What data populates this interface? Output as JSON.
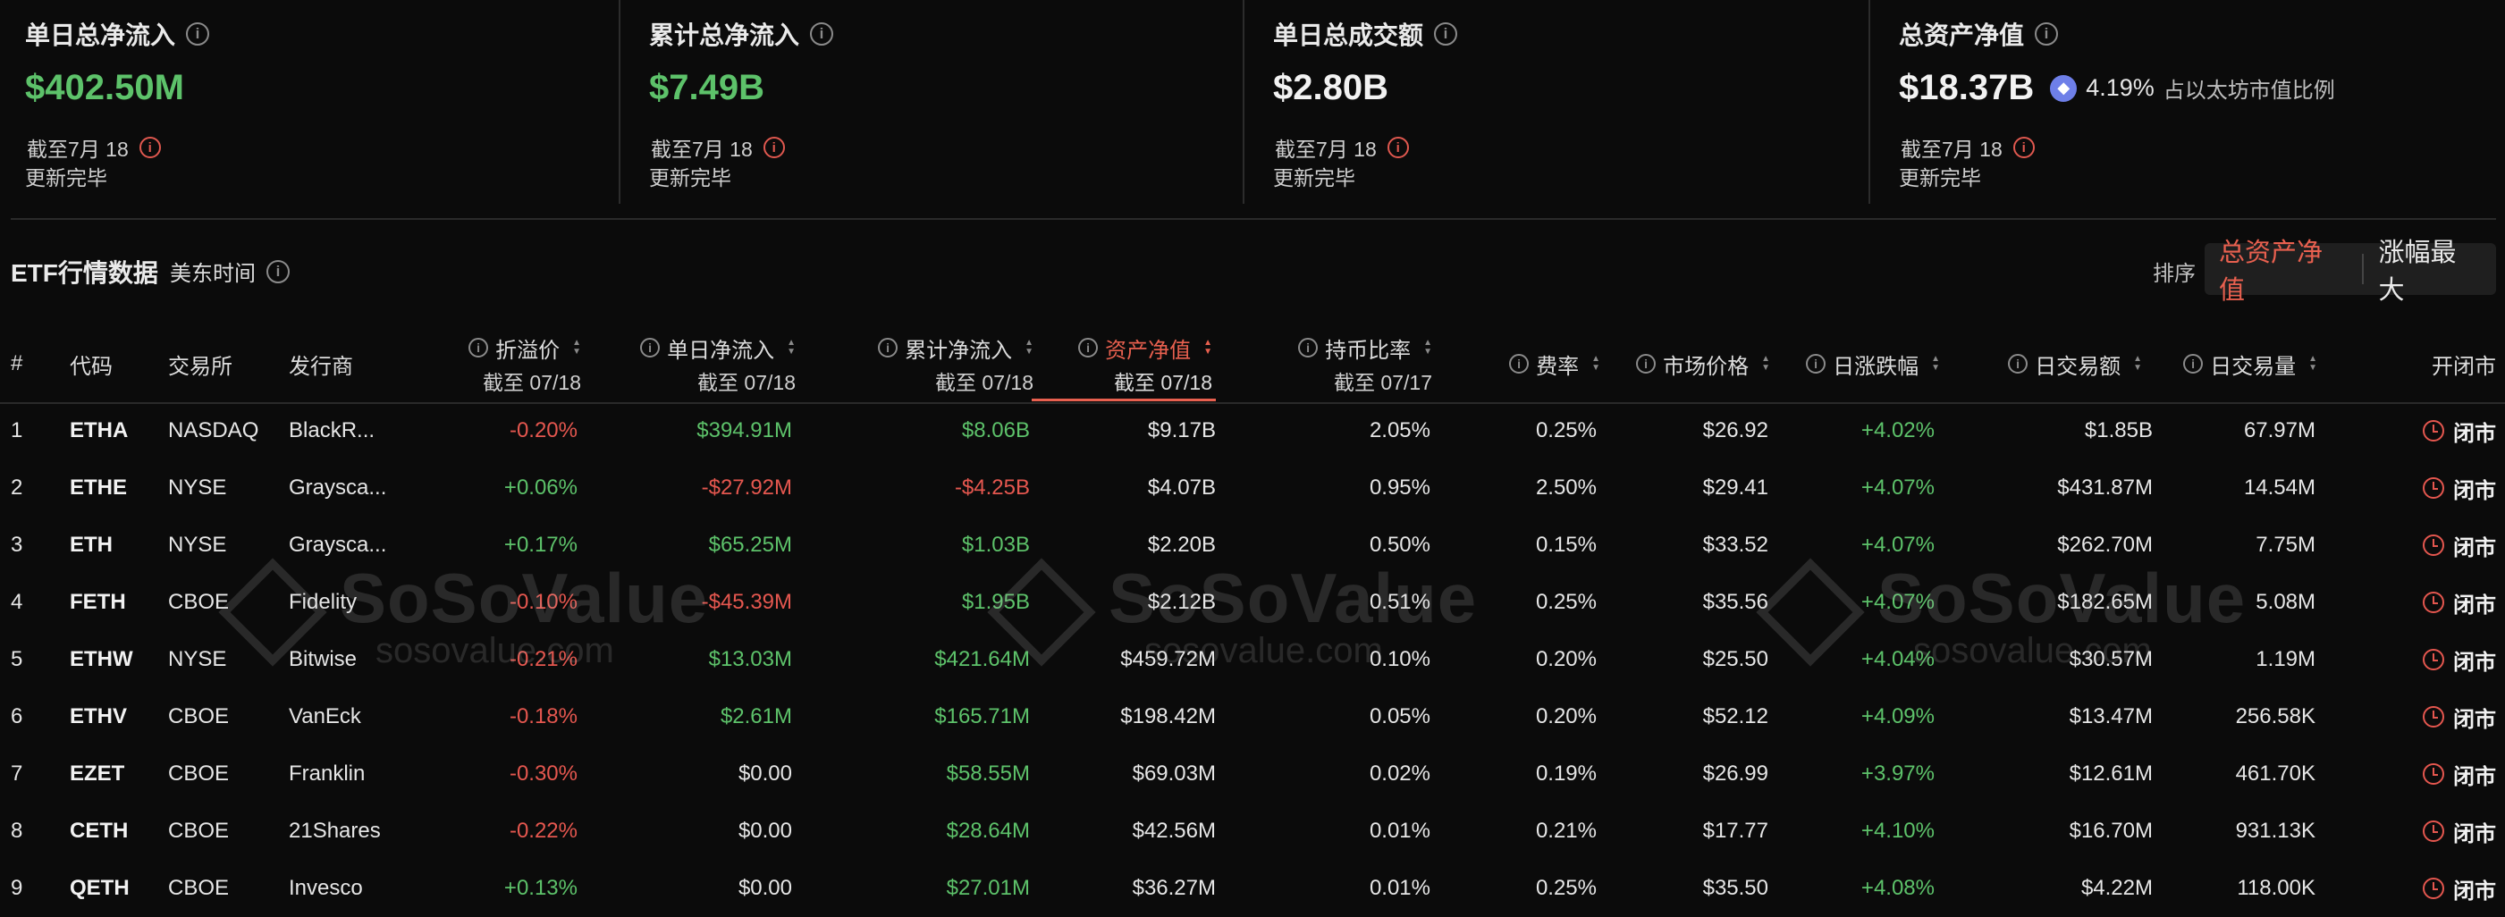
{
  "summary": [
    {
      "title": "单日总净流入",
      "value": "$402.50M",
      "date": "截至7月 18",
      "status": "更新完毕"
    },
    {
      "title": "累计总净流入",
      "value": "$7.49B",
      "date": "截至7月 18",
      "status": "更新完毕"
    },
    {
      "title": "单日总成交额",
      "value": "$2.80B",
      "date": "截至7月 18",
      "status": "更新完毕"
    },
    {
      "title": "总资产净值",
      "value": "$18.37B",
      "ratio": "4.19%",
      "ratio_label": "占以太坊市值比例",
      "date": "截至7月 18",
      "status": "更新完毕"
    }
  ],
  "section": {
    "title": "ETF行情数据",
    "timezone": "美东时间",
    "sort_label": "排序",
    "sort_options": [
      "总资产净值",
      "涨幅最大"
    ],
    "active_sort": "总资产净值"
  },
  "table": {
    "headers": {
      "index": "#",
      "code": "代码",
      "exchange": "交易所",
      "issuer": "发行商",
      "premium": "折溢价",
      "premium_sub": "截至 07/18",
      "daily_inflow": "单日净流入",
      "daily_inflow_sub": "截至 07/18",
      "cum_inflow": "累计净流入",
      "cum_inflow_sub": "截至 07/18",
      "nav": "资产净值",
      "nav_sub": "截至 07/18",
      "holding": "持币比率",
      "holding_sub": "截至 07/17",
      "fee": "费率",
      "price": "市场价格",
      "change": "日涨跌幅",
      "turnover": "日交易额",
      "volume": "日交易量",
      "open_close": "开闭市"
    },
    "rows": [
      {
        "n": "1",
        "code": "ETHA",
        "exchange": "NASDAQ",
        "issuer": "BlackR...",
        "premium": "-0.20%",
        "daily": "$394.91M",
        "cum": "$8.06B",
        "nav": "$9.17B",
        "holding": "2.05%",
        "fee": "0.25%",
        "price": "$26.92",
        "change": "+4.02%",
        "turnover": "$1.85B",
        "volume": "67.97M",
        "status": "闭市"
      },
      {
        "n": "2",
        "code": "ETHE",
        "exchange": "NYSE",
        "issuer": "Graysca...",
        "premium": "+0.06%",
        "daily": "-$27.92M",
        "cum": "-$4.25B",
        "nav": "$4.07B",
        "holding": "0.95%",
        "fee": "2.50%",
        "price": "$29.41",
        "change": "+4.07%",
        "turnover": "$431.87M",
        "volume": "14.54M",
        "status": "闭市"
      },
      {
        "n": "3",
        "code": "ETH",
        "exchange": "NYSE",
        "issuer": "Graysca...",
        "premium": "+0.17%",
        "daily": "$65.25M",
        "cum": "$1.03B",
        "nav": "$2.20B",
        "holding": "0.50%",
        "fee": "0.15%",
        "price": "$33.52",
        "change": "+4.07%",
        "turnover": "$262.70M",
        "volume": "7.75M",
        "status": "闭市"
      },
      {
        "n": "4",
        "code": "FETH",
        "exchange": "CBOE",
        "issuer": "Fidelity",
        "premium": "-0.10%",
        "daily": "-$45.39M",
        "cum": "$1.95B",
        "nav": "$2.12B",
        "holding": "0.51%",
        "fee": "0.25%",
        "price": "$35.56",
        "change": "+4.07%",
        "turnover": "$182.65M",
        "volume": "5.08M",
        "status": "闭市"
      },
      {
        "n": "5",
        "code": "ETHW",
        "exchange": "NYSE",
        "issuer": "Bitwise",
        "premium": "-0.21%",
        "daily": "$13.03M",
        "cum": "$421.64M",
        "nav": "$459.72M",
        "holding": "0.10%",
        "fee": "0.20%",
        "price": "$25.50",
        "change": "+4.04%",
        "turnover": "$30.57M",
        "volume": "1.19M",
        "status": "闭市"
      },
      {
        "n": "6",
        "code": "ETHV",
        "exchange": "CBOE",
        "issuer": "VanEck",
        "premium": "-0.18%",
        "daily": "$2.61M",
        "cum": "$165.71M",
        "nav": "$198.42M",
        "holding": "0.05%",
        "fee": "0.20%",
        "price": "$52.12",
        "change": "+4.09%",
        "turnover": "$13.47M",
        "volume": "256.58K",
        "status": "闭市"
      },
      {
        "n": "7",
        "code": "EZET",
        "exchange": "CBOE",
        "issuer": "Franklin",
        "premium": "-0.30%",
        "daily": "$0.00",
        "cum": "$58.55M",
        "nav": "$69.03M",
        "holding": "0.02%",
        "fee": "0.19%",
        "price": "$26.99",
        "change": "+3.97%",
        "turnover": "$12.61M",
        "volume": "461.70K",
        "status": "闭市"
      },
      {
        "n": "8",
        "code": "CETH",
        "exchange": "CBOE",
        "issuer": "21Shares",
        "premium": "-0.22%",
        "daily": "$0.00",
        "cum": "$28.64M",
        "nav": "$42.56M",
        "holding": "0.01%",
        "fee": "0.21%",
        "price": "$17.77",
        "change": "+4.10%",
        "turnover": "$16.70M",
        "volume": "931.13K",
        "status": "闭市"
      },
      {
        "n": "9",
        "code": "QETH",
        "exchange": "CBOE",
        "issuer": "Invesco",
        "premium": "+0.13%",
        "daily": "$0.00",
        "cum": "$27.01M",
        "nav": "$36.27M",
        "holding": "0.01%",
        "fee": "0.25%",
        "price": "$35.50",
        "change": "+4.08%",
        "turnover": "$4.22M",
        "volume": "118.00K",
        "status": "闭市"
      }
    ]
  },
  "watermark": {
    "brand": "SoSoValue",
    "url": "sosovalue.com"
  },
  "colors": {
    "positive": "#5dc26a",
    "negative": "#e5574f",
    "accent": "#e8604f",
    "background": "#0b0b0b"
  }
}
